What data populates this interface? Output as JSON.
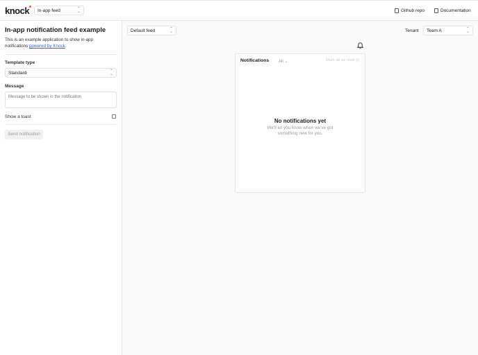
{
  "header": {
    "logo": "knock",
    "feed_select": "In-app feed",
    "github": "Github repo",
    "docs": "Documentation"
  },
  "sidebar": {
    "title": "In-app notification feed example",
    "desc_prefix": "This is an example application to show in-app notifications ",
    "desc_link": "powered by Knock",
    "desc_suffix": ".",
    "template_label": "Template type",
    "template_value": "Standard",
    "message_label": "Message",
    "message_placeholder": "Message to be shown in the notification",
    "toast_label": "Show a toast",
    "send_label": "Send notification"
  },
  "main": {
    "feed_select": "Default feed",
    "tenant_label": "Tenant",
    "tenant_value": "Team A",
    "panel": {
      "title": "Notifications",
      "filter": "All",
      "mark_all": "Mark all as read",
      "empty_title": "No notifications yet",
      "empty_sub_1": "We'll let you know when we've got",
      "empty_sub_2": "something new for you."
    }
  }
}
